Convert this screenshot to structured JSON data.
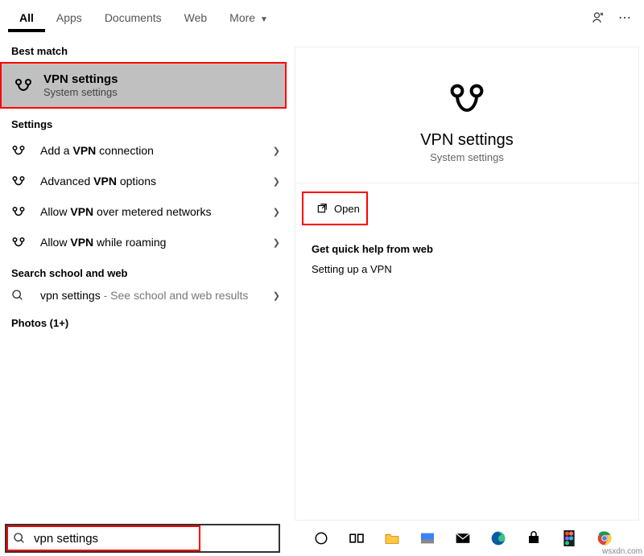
{
  "tabs": {
    "all": "All",
    "apps": "Apps",
    "documents": "Documents",
    "web": "Web",
    "more": "More"
  },
  "section": {
    "best_match": "Best match",
    "settings": "Settings",
    "search_web": "Search school and web",
    "photos": "Photos (1+)"
  },
  "best_match": {
    "title": "VPN settings",
    "subtitle": "System settings"
  },
  "settings_rows": {
    "r0_pre": "Add a ",
    "r0_b": "VPN",
    "r0_post": " connection",
    "r1_pre": "Advanced ",
    "r1_b": "VPN",
    "r1_post": " options",
    "r2_pre": "Allow ",
    "r2_b": "VPN",
    "r2_post": " over metered networks",
    "r3_pre": "Allow ",
    "r3_b": "VPN",
    "r3_post": " while roaming"
  },
  "web_row": {
    "query": "vpn settings",
    "suffix": " - See school and web results"
  },
  "hero": {
    "title": "VPN settings",
    "subtitle": "System settings"
  },
  "open": {
    "label": "Open"
  },
  "help": {
    "title": "Get quick help from web",
    "link0": "Setting up a VPN"
  },
  "search": {
    "value": "vpn settings"
  },
  "watermark": "wsxdn.com"
}
